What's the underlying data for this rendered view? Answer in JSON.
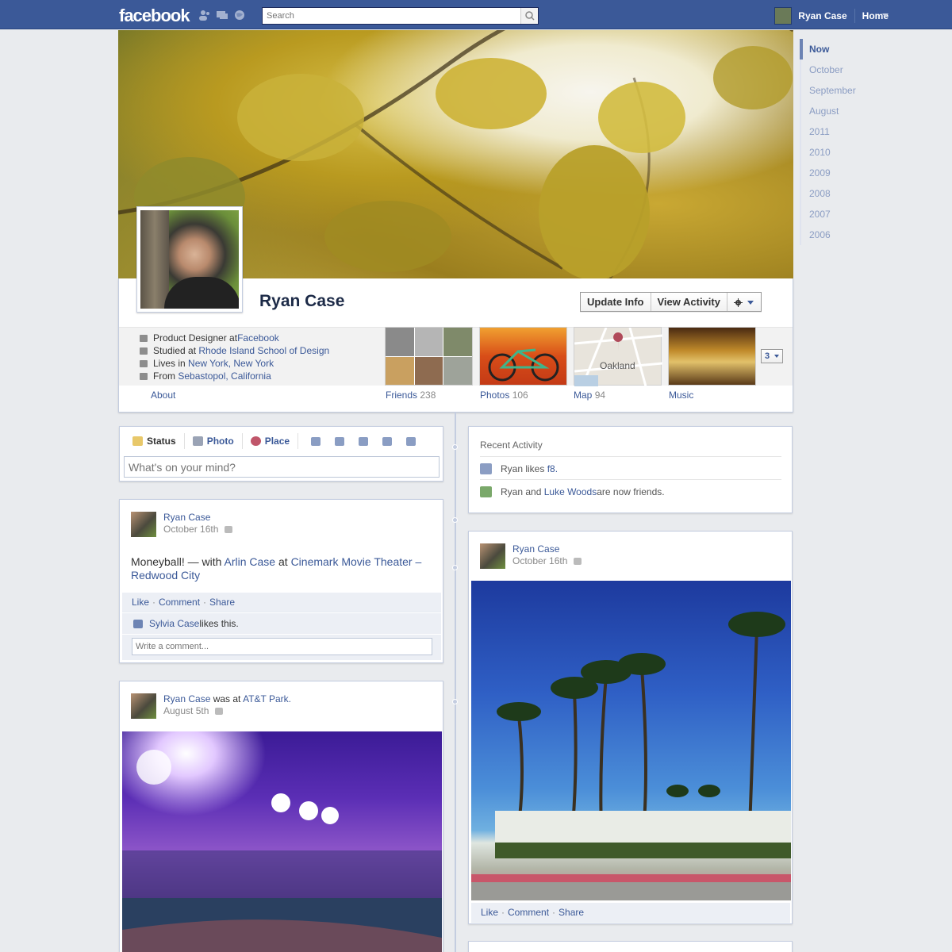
{
  "topbar": {
    "logo": "facebook",
    "search_placeholder": "Search",
    "user_name": "Ryan Case",
    "home_label": "Home"
  },
  "profile": {
    "name": "Ryan Case",
    "buttons": {
      "update_info": "Update Info",
      "view_activity": "View Activity"
    },
    "info": [
      {
        "prefix": "Product Designer at ",
        "link": "Facebook",
        "suffix": ""
      },
      {
        "prefix": "Studied at ",
        "link": "Rhode Island School of Design",
        "suffix": ""
      },
      {
        "prefix": "Lives in ",
        "link": "New York, New York",
        "suffix": ""
      },
      {
        "prefix": "From ",
        "link": "Sebastopol, California",
        "suffix": ""
      }
    ],
    "about_label": "About"
  },
  "sections": {
    "friends": {
      "label": "Friends",
      "count": "238"
    },
    "photos": {
      "label": "Photos",
      "count": "106"
    },
    "map": {
      "label": "Map",
      "count": "94",
      "city": "Oakland"
    },
    "music": {
      "label": "Music"
    },
    "more_count": "3"
  },
  "timeline_nav": [
    "Now",
    "October",
    "September",
    "August",
    "2011",
    "2010",
    "2009",
    "2008",
    "2007",
    "2006"
  ],
  "composer": {
    "tabs": [
      "Status",
      "Photo",
      "Place"
    ],
    "placeholder": "What's on your mind?"
  },
  "recent_activity": {
    "title": "Recent Activity",
    "items": [
      {
        "text1": "Ryan likes ",
        "link1": "f8.",
        "text2": "",
        "link2": "",
        "text3": ""
      },
      {
        "text1": "Ryan and ",
        "link1": "Luke Woods",
        "text2": " are now friends.",
        "link2": "",
        "text3": ""
      }
    ]
  },
  "posts": {
    "moneyball": {
      "author": "Ryan Case",
      "date": "October 16th",
      "text": "Moneyball! — with ",
      "with": "Arlin Case",
      "at_word": " at ",
      "place": "Cinemark Movie Theater – Redwood City",
      "actions": [
        "Like",
        "Comment",
        "Share"
      ],
      "liker": "Sylvia Case",
      "likes_suffix": " likes this.",
      "comment_placeholder": "Write a comment..."
    },
    "palms": {
      "author": "Ryan Case",
      "date": "October 16th",
      "actions": [
        "Like",
        "Comment",
        "Share"
      ]
    },
    "att": {
      "author": "Ryan Case",
      "was_at": " was at ",
      "place": "AT&T Park.",
      "date": "August 5th"
    }
  },
  "colors": {
    "brand": "#3b5998",
    "link": "#3b5998",
    "background": "#e9ebee"
  }
}
